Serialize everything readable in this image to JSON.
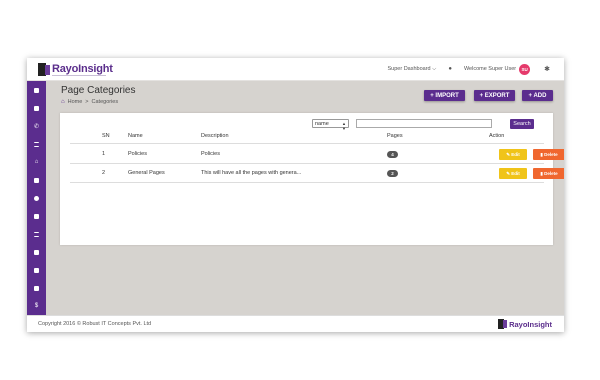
{
  "brand": {
    "name": "RayoInsight",
    "primary": "#5b2d8e"
  },
  "header": {
    "dashboard_label": "Super Dashboard",
    "welcome": "Welcome Super User",
    "avatar_initials": "SU"
  },
  "sidebar": {
    "items": [
      {
        "icon": "dashboard-icon"
      },
      {
        "icon": "file-icon"
      },
      {
        "icon": "phone-icon"
      },
      {
        "icon": "list-icon"
      },
      {
        "icon": "home-icon"
      },
      {
        "icon": "book-icon"
      },
      {
        "icon": "settings-icon"
      },
      {
        "icon": "image-icon"
      },
      {
        "icon": "menu-icon"
      },
      {
        "icon": "mail-icon"
      },
      {
        "icon": "grid-icon"
      },
      {
        "icon": "document-icon"
      },
      {
        "icon": "dollar-icon"
      }
    ]
  },
  "page": {
    "title": "Page Categories",
    "breadcrumb": {
      "home": "Home",
      "separator": ">",
      "current": "Categories"
    },
    "actions": {
      "import": "+ IMPORT",
      "export": "+ EXPORT",
      "add": "+ ADD"
    }
  },
  "filter": {
    "field": "name",
    "search_label": "Search",
    "search_value": ""
  },
  "table": {
    "columns": [
      "SN",
      "Name",
      "Description",
      "Pages",
      "Action"
    ],
    "rows": [
      {
        "sn": "1",
        "name": "Policies",
        "description": "Policies",
        "pages": "4"
      },
      {
        "sn": "2",
        "name": "General Pages",
        "description": "This will have all the pages with genera...",
        "pages": "2"
      }
    ],
    "edit_label": "Edit",
    "delete_label": "Delete"
  },
  "footer": {
    "copyright": "Copyright 2016 © Robust IT Concepts Pvt. Ltd"
  }
}
